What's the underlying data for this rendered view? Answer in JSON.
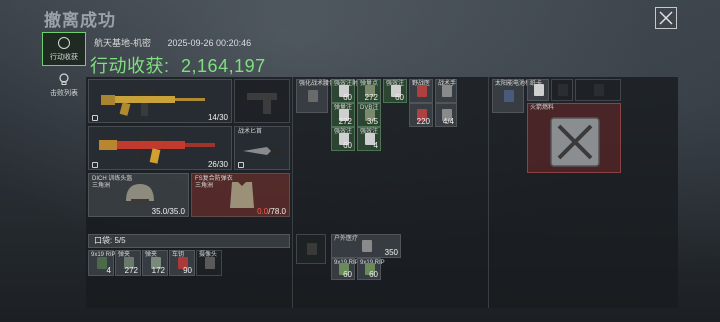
{
  "header": {
    "title": "撤离成功"
  },
  "side_tabs": [
    {
      "label": "行动收获",
      "active": true
    },
    {
      "label": "击败列表",
      "active": false
    }
  ],
  "location": {
    "map": "航天基地-机密",
    "datetime": "2025-09-26 00:20:46"
  },
  "income": {
    "label": "行动收获:",
    "value": "2,164,197"
  },
  "equipment": {
    "primary": {
      "count": "14/30"
    },
    "secondary": {
      "count": "26/30"
    },
    "melee": {
      "name": "战术匕首"
    },
    "helmet": {
      "name": "DICH 训练头盔",
      "sub": "三角洲",
      "durability": "35.0/35.0"
    },
    "armor": {
      "name": "FS复合防弹衣",
      "sub": "三角洲",
      "durability_current": "0.0",
      "durability_max": "/78.0"
    }
  },
  "pockets": {
    "label": "口袋: 5/5",
    "items": [
      {
        "name": "9x19 RIP",
        "count": "4"
      },
      {
        "name": "弹夹",
        "count": "272"
      },
      {
        "name": "弹夹",
        "count": "172"
      },
      {
        "name": "车钥",
        "count": "90"
      },
      {
        "name": "摄像头",
        "count": ""
      }
    ]
  },
  "chest_rig": {
    "items": [
      {
        "name": "强化战术腰包",
        "count": ""
      },
      {
        "name": "强效注射",
        "count": "60"
      },
      {
        "name": "弹量点",
        "count": "272"
      },
      {
        "name": "强效注",
        "count": "60"
      },
      {
        "name": "野战医",
        "count": ""
      },
      {
        "name": "战术手",
        "count": ""
      },
      {
        "name": "弹量注",
        "count": "272"
      },
      {
        "name": "DVB注",
        "count": "3/5"
      },
      {
        "name": "",
        "count": "220"
      },
      {
        "name": "",
        "count": "4/4"
      },
      {
        "name": "强效注",
        "count": "60"
      },
      {
        "name": "强效注",
        "count": "4"
      }
    ]
  },
  "backpack": {
    "items": [
      {
        "name": "户外医疗",
        "count": "350"
      },
      {
        "name": "9x19 RIP",
        "count": "60"
      },
      {
        "name": "9x19 RIP",
        "count": "60"
      }
    ]
  },
  "loot": {
    "items": [
      {
        "name": "太阳能电池板",
        "count": ""
      },
      {
        "name": "纸卡",
        "count": ""
      },
      {
        "name": "火箭燃料",
        "count": ""
      }
    ]
  }
}
